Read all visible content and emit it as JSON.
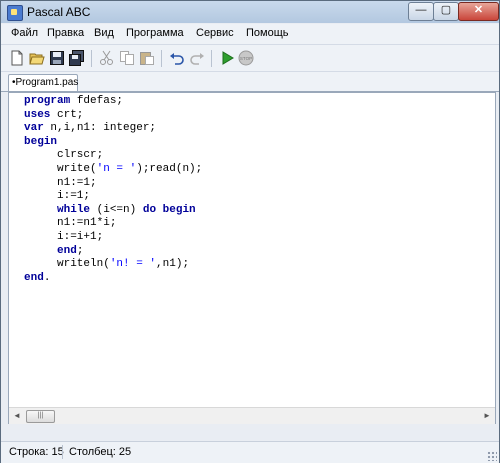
{
  "window": {
    "title": "Pascal ABC",
    "min": "—",
    "max": "▢",
    "close": "✕"
  },
  "menu": [
    "Файл",
    "Правка",
    "Вид",
    "Программа",
    "Сервис",
    "Помощь"
  ],
  "toolbar": {
    "icons": [
      "new-file-icon",
      "open-folder-icon",
      "save-icon",
      "save-all-icon",
      "cut-icon",
      "copy-icon",
      "paste-icon",
      "undo-icon",
      "redo-icon",
      "run-icon",
      "stop-icon"
    ],
    "stop_label": "STOP"
  },
  "tabs": [
    {
      "label": "•Program1.pas"
    }
  ],
  "editor": {
    "lines": [
      [
        [
          "kw",
          "program"
        ],
        [
          "t",
          " fdefas;"
        ]
      ],
      [
        [
          "kw",
          "uses"
        ],
        [
          "t",
          " crt;"
        ]
      ],
      [
        [
          "kw",
          "var"
        ],
        [
          "t",
          " n,i,n1: integer;"
        ]
      ],
      [
        [
          "kw",
          "begin"
        ]
      ],
      [
        [
          "t",
          "     clrscr;"
        ]
      ],
      [
        [
          "t",
          "     write("
        ],
        [
          "str",
          "'n = '"
        ],
        [
          "t",
          ");read(n);"
        ]
      ],
      [
        [
          "t",
          "     n1:=1;"
        ]
      ],
      [
        [
          "t",
          "     i:=1;"
        ]
      ],
      [
        [
          "t",
          "     "
        ],
        [
          "kw",
          "while"
        ],
        [
          "t",
          " (i<=n) "
        ],
        [
          "kw",
          "do begin"
        ]
      ],
      [
        [
          "t",
          "     n1:=n1*i;"
        ]
      ],
      [
        [
          "t",
          "     i:=i+1;"
        ]
      ],
      [
        [
          "t",
          "     "
        ],
        [
          "kw",
          "end"
        ],
        [
          "t",
          ";"
        ]
      ],
      [
        [
          "t",
          "     writeln("
        ],
        [
          "str",
          "'n! = '"
        ],
        [
          "t",
          ",n1);"
        ]
      ],
      [
        [
          "kw",
          "end"
        ],
        [
          "t",
          "."
        ]
      ]
    ]
  },
  "scrollbar": {
    "left": "◄",
    "right": "►",
    "thumb": "|||"
  },
  "status": {
    "line": "Строка: 15",
    "col": "Столбец: 25"
  },
  "colors": {
    "keyword": "#000099",
    "string": "#0000ff",
    "run": "#2e9e2e"
  }
}
